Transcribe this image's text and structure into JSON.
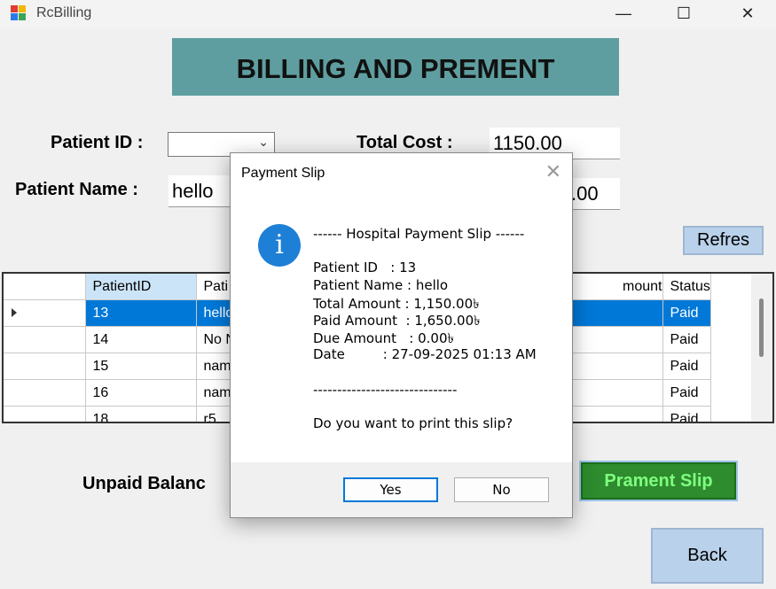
{
  "window": {
    "title": "RcBilling",
    "minimize": "—",
    "maximize": "☐",
    "close": "✕"
  },
  "banner": "BILLING AND PREMENT",
  "form": {
    "patient_id_label": "Patient ID :",
    "patient_name_label": "Patient Name :",
    "patient_name_value": "hello",
    "total_cost_label": "Total Cost :",
    "total_cost_value": "1150.00",
    "second_value_visible": ".00"
  },
  "refresh_label": "Refres",
  "grid": {
    "columns": [
      "PatientID",
      "Pati",
      "mount",
      "Status"
    ],
    "rows": [
      {
        "id": "13",
        "name": "hello",
        "status": "Paid",
        "active": true
      },
      {
        "id": "14",
        "name": "No N",
        "status": "Paid"
      },
      {
        "id": "15",
        "name": "name",
        "status": "Paid"
      },
      {
        "id": "16",
        "name": "name",
        "status": "Paid"
      },
      {
        "id": "18",
        "name": "r5",
        "status": "Paid"
      }
    ]
  },
  "unpaid_label": "Unpaid Balanc",
  "slip_button": "Prament Slip",
  "back_button": "Back",
  "dialog": {
    "title": "Payment Slip",
    "icon": "info-icon",
    "heading": "------ Hospital Payment Slip ------",
    "patient_id": "Patient ID   : 13",
    "patient_name": "Patient Name : hello",
    "total_amount": "Total Amount : 1,150.00৳",
    "paid_amount": "Paid Amount  : 1,650.00৳",
    "due_amount": "Due Amount   : 0.00৳",
    "date": "Date         : 27-09-2025 01:13 AM",
    "separator": "------------------------------",
    "question": "Do you want to print this slip?",
    "yes": "Yes",
    "no": "No"
  }
}
